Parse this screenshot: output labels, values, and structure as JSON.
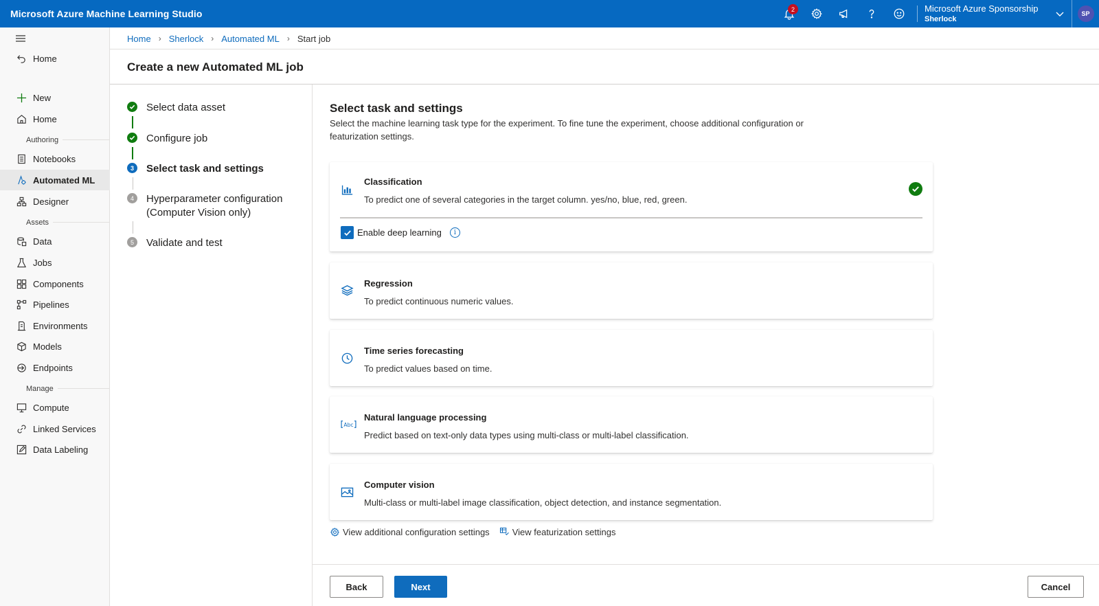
{
  "topbar": {
    "app_title": "Microsoft Azure Machine Learning Studio",
    "notification_count": "2",
    "subscription": "Microsoft Azure Sponsorship",
    "workspace": "Sherlock",
    "avatar_initials": "SP",
    "icons": [
      "bell-icon",
      "gear-icon",
      "megaphone-icon",
      "help-icon",
      "smiley-icon",
      "chevron-down-icon"
    ]
  },
  "sidebar": {
    "back_home": "Home",
    "new": "New",
    "home": "Home",
    "groups": {
      "authoring": "Authoring",
      "assets": "Assets",
      "manage": "Manage"
    },
    "items": {
      "notebooks": "Notebooks",
      "automated_ml": "Automated ML",
      "designer": "Designer",
      "data": "Data",
      "jobs": "Jobs",
      "components": "Components",
      "pipelines": "Pipelines",
      "environments": "Environments",
      "models": "Models",
      "endpoints": "Endpoints",
      "compute": "Compute",
      "linked_services": "Linked Services",
      "data_labeling": "Data Labeling"
    }
  },
  "breadcrumb": [
    "Home",
    "Sherlock",
    "Automated ML",
    "Start job"
  ],
  "page_title": "Create a new Automated ML job",
  "steps": [
    {
      "num": "1",
      "label": "Select data asset",
      "state": "done"
    },
    {
      "num": "2",
      "label": "Configure job",
      "state": "done"
    },
    {
      "num": "3",
      "label": "Select task and settings",
      "state": "current"
    },
    {
      "num": "4",
      "label": "Hyperparameter configuration (Computer Vision only)",
      "state": "todo"
    },
    {
      "num": "5",
      "label": "Validate and test",
      "state": "todo"
    }
  ],
  "content": {
    "title": "Select task and settings",
    "description": "Select the machine learning task type for the experiment. To fine tune the experiment, choose additional configuration or featurization settings."
  },
  "tasks": [
    {
      "title": "Classification",
      "desc": "To predict one of several categories in the target column. yes/no, blue, red, green.",
      "selected": true
    },
    {
      "title": "Regression",
      "desc": "To predict continuous numeric values."
    },
    {
      "title": "Time series forecasting",
      "desc": "To predict values based on time."
    },
    {
      "title": "Natural language processing",
      "desc": "Predict based on text-only data types using multi-class or multi-label classification."
    },
    {
      "title": "Computer vision",
      "desc": "Multi-class or multi-label image classification, object detection, and instance segmentation."
    }
  ],
  "deep_learning": {
    "label": "Enable deep learning",
    "checked": true
  },
  "links": {
    "additional": "View additional configuration settings",
    "featurization": "View featurization settings"
  },
  "buttons": {
    "back": "Back",
    "next": "Next",
    "cancel": "Cancel"
  },
  "colors": {
    "topbar": "#0669c1",
    "accent": "#0f6cbd",
    "success": "#107c10",
    "badge": "#c50f1f"
  }
}
